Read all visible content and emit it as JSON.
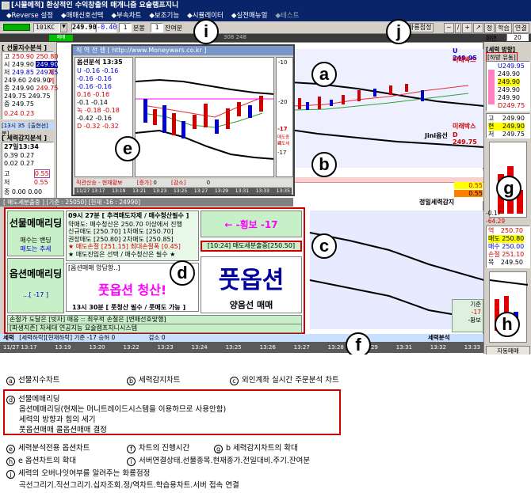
{
  "titlebar": {
    "title": "[시뮬메적] 환상적인 수익창출의 매개니즘 요술램프지니"
  },
  "menubar": {
    "items": [
      "◆Reverse 설정",
      "◆매매신호선택",
      "◆부속차트",
      "◆보조기능",
      "◆시뮬레이터",
      "◆실전매뉴얼",
      "◆테스트"
    ]
  },
  "toolbar": {
    "code": "101KC",
    "price": "249.90",
    "change": "-0.40",
    "bun_value": "1",
    "bun_label": "분봉",
    "janyeo_value": "1",
    "janyeo_label": "잔여분",
    "pokeo": "화룡점정",
    "tools": [
      "~",
      "/",
      "+",
      "↗",
      "정",
      "학습",
      "연결"
    ],
    "screen_label": "화면",
    "screen_value": "20"
  },
  "left_panel": {
    "futures_title": "[ 선물지수분석 ]",
    "futures_rows": [
      [
        "고",
        "250.90",
        "250.80"
      ],
      [
        "시",
        "249.90",
        "249.90"
      ],
      [
        "저",
        "249.85",
        "249.85"
      ],
      [
        "",
        "249.60",
        "249.90"
      ],
      [
        "종",
        "249.90",
        "249.75"
      ],
      [
        "",
        "249.75",
        "249.75"
      ],
      [
        "중",
        "249.75",
        ""
      ],
      [
        "",
        "0.24",
        "0.23"
      ]
    ],
    "futures_side": [
      "지",
      "기"
    ],
    "time_tab_a": "[13시 35분]",
    "time_tab_b": "[출현선]",
    "force_title": "[ 세력감지분석 ]",
    "force_time": "27일13:34",
    "force_label": "매수",
    "force_rows": [
      [
        "",
        "0.39",
        "0.27"
      ],
      [
        "",
        "0.02",
        "0.27"
      ],
      [
        "고",
        "",
        "0.55"
      ],
      [
        "저",
        "",
        "0.55"
      ],
      [
        "종",
        "0.00",
        "0.00"
      ]
    ]
  },
  "popup": {
    "title": "직 역 전 쟁 [ http://www.Moneywars.co.kr ]",
    "info_title": "옵션분석",
    "info_time": "13:35",
    "info_rows": [
      [
        "U",
        "-0.16",
        "-0.16"
      ],
      [
        "",
        "-0.16",
        "-0.16"
      ],
      [
        "",
        "-0.16",
        "-0.16"
      ],
      [
        "",
        "0.16",
        "-0.16"
      ],
      [
        "",
        "-0.1",
        "-0.14"
      ],
      [
        "녹",
        "-0.18",
        "-0.18"
      ],
      [
        "",
        "-0.42",
        "-0.16"
      ],
      [
        "D",
        "-0.32",
        "-0.32"
      ]
    ],
    "right_ticks": [
      "-10",
      "-20",
      "-17",
      "-17"
    ],
    "right_labels": [
      "매도종료",
      "매도세"
    ],
    "bottom_values": [
      "0.55",
      "0.55"
    ],
    "status_left": "직관산승 - 현재황보",
    "status_mid": "[증가]",
    "status_mid_val": "0",
    "status_right": "[감소]",
    "status_right_val": "0",
    "time_axis": [
      "11/27 13:17",
      "13:19",
      "13:21",
      "13:23",
      "13:25",
      "13:27",
      "13:29",
      "13:31",
      "13:33",
      "13:35"
    ],
    "footer": "[ 매도세분출중 ] [기준 : 25050] [현재 -16 : 24990]"
  },
  "main_chart": {
    "label_a": "Jini옵선",
    "label_a2": "D 249.75",
    "label_mirabox": "미래박스",
    "label_jeongmil": "정밀세력감지",
    "top_right_prices": [
      "U 249.95",
      "미래박스"
    ],
    "mid_values": [
      "0.55",
      "0.55"
    ],
    "header_code": "308 248"
  },
  "right_panel": {
    "force_dir_title": "[세력 방향]",
    "force_dir_sub": "[하방 유동]",
    "price_list": [
      "U249.95",
      "249.90",
      "249.90",
      "249.90",
      "249.90",
      "D249.75"
    ],
    "side_labels": [
      "고",
      "현",
      "저"
    ],
    "side_values": [
      "249.90",
      "249.90",
      "249.75"
    ],
    "side_rows": [
      [
        "역",
        "250.70"
      ],
      [
        "매도",
        "250.80"
      ],
      [
        "매수",
        "250.00"
      ],
      [
        "손절",
        "251.10"
      ],
      [
        "목",
        "249.50"
      ]
    ],
    "top_vals": [
      "-0.17",
      "-64.29"
    ],
    "bottom_label": "자동매매",
    "ref_box": [
      "기준",
      "-17",
      "-황보"
    ]
  },
  "strategy": {
    "left_title_1": "선물메매리딩",
    "left_sub_1": "매수는 밴딩",
    "left_sub_2": "매도는 추세",
    "left_title_2": "옵션메매리딩",
    "left_sub_3": "...[ -17 ]",
    "time_line": "09시 27분 [ 추격매도자제 / 매수청산필수 ]",
    "line2": "약매도: 매수청산은 250.70 이상에서 진행",
    "line3": "신규매도 [250.70]    1차매도 [250.70]",
    "line4": "권장매도 [250.80]    2차매도 [250.85]",
    "line5": "★ 매도손절 [251.15]   최대손절폭 [0.45]",
    "line6": "★ 매도진입은 선택 / 매수청산은 필수 ★",
    "arrow_text": "← -횡보 -17",
    "tag_text": "[10:24] 매도세분출중[250.50]",
    "option_header": "[옵션매매 앙답항..]",
    "option_big": "풋옵션 청산!",
    "big_word": "풋옵션",
    "big_sub": "양음선 매매",
    "option_time": "13시 30분 [ 풋청산 필수 / 풋매도 가능 ]",
    "bottom1": "손절가 도달은 [빗자] 매응 :: 최우적 손절은 [변매선호맞행]",
    "bottom2": "[파생지존] 차세대 연공지능 요술램프지니시스템"
  },
  "bottom_strip": {
    "label_left": "세력",
    "label_mid": "[세력하락][현재하락] 기준 -17 승허 0",
    "label_mid2": "감소 0",
    "label_right": "세력분석",
    "axis": [
      "11/27 13:17",
      "13:19",
      "13:20",
      "13:22",
      "13:23",
      "13:24",
      "13:25",
      "13:26",
      "13:27",
      "13:28",
      "13:29",
      "13:31",
      "13:32",
      "13:33"
    ]
  },
  "callouts": {
    "a": "a",
    "b": "b",
    "c": "c",
    "d": "d",
    "e": "e",
    "f": "f",
    "g": "g",
    "h": "h",
    "i": "i",
    "j": "j"
  },
  "legend": {
    "row1": [
      {
        "key": "a",
        "text": "선물지수차트"
      },
      {
        "key": "b",
        "text": "세력감지차트"
      },
      {
        "key": "c",
        "text": "외인계좌 실시간 주문분석 차트"
      }
    ],
    "d_title": "선물메매리딩",
    "d_lines": [
      "옵션메매리딩(현재는 머니트레이드시스템을 이용하므로 사용안함)",
      "세력의 방향과 힘의 세기",
      "풋옵션매매 콜옵션매매 결정"
    ],
    "row3": [
      {
        "key": "e",
        "text": "세력분석전용 옵션차트"
      },
      {
        "key": "f",
        "text": "차트의 진행시간"
      },
      {
        "key": "g",
        "text": "b 세력감지차트의 확대"
      }
    ],
    "row4": [
      {
        "key": "h",
        "text": "e  옵션차트의 확대"
      },
      {
        "key": "i",
        "text": "서버연결상태.선물종목.현재종가.전일대비.주기.잔여분"
      }
    ],
    "j_title": "세력의 오버나잇여부를 알려주는 화룡점정",
    "j_line": "곡선그리기.직선그리기.십자조회.정/역차트.학습용차트.서버 접속 연결"
  },
  "colors": {
    "titlebar": "#0a246a",
    "accent_red": "#d00000",
    "panel_grey": "#d4d0c8",
    "highlight_green": "#c8f0c8",
    "yellow": "#ffff00"
  }
}
